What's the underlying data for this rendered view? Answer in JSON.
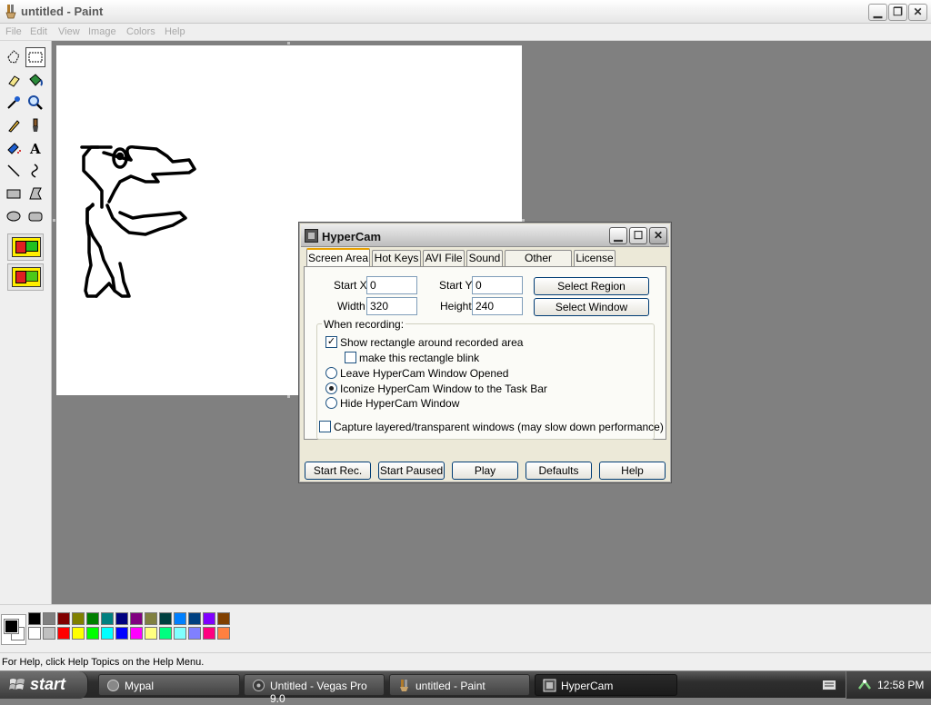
{
  "paint": {
    "title": "untitled - Paint",
    "menu": [
      "File",
      "Edit",
      "View",
      "Image",
      "Colors",
      "Help"
    ],
    "status": "For Help, click Help Topics on the Help Menu.",
    "palette_top": [
      "#000000",
      "#808080",
      "#800000",
      "#808000",
      "#008000",
      "#008080",
      "#000080",
      "#800080",
      "#808040",
      "#004040",
      "#0080ff",
      "#004080",
      "#8000ff",
      "#804000"
    ],
    "palette_bottom": [
      "#ffffff",
      "#c0c0c0",
      "#ff0000",
      "#ffff00",
      "#00ff00",
      "#00ffff",
      "#0000ff",
      "#ff00ff",
      "#ffff80",
      "#00ff80",
      "#80ffff",
      "#8080ff",
      "#ff0080",
      "#ff8040"
    ],
    "tools": [
      "free-select",
      "rect-select",
      "eraser",
      "fill",
      "color-picker",
      "magnifier",
      "pencil",
      "brush",
      "airbrush",
      "text",
      "line",
      "curve",
      "rectangle",
      "polygon",
      "ellipse",
      "rounded-rect"
    ]
  },
  "hypercam": {
    "title": "HyperCam",
    "tabs": [
      "Screen Area",
      "Hot Keys",
      "AVI File",
      "Sound",
      "Other Options",
      "License"
    ],
    "active_tab": "Screen Area",
    "start_x_label": "Start X",
    "start_x": "0",
    "start_y_label": "Start Y",
    "start_y": "0",
    "width_label": "Width",
    "width": "320",
    "height_label": "Height",
    "height": "240",
    "select_region": "Select Region",
    "select_window": "Select Window",
    "group_title": "When recording:",
    "show_rect": "Show rectangle around recorded area",
    "blink": "make this rectangle blink",
    "leave_opened": "Leave HyperCam Window Opened",
    "iconize": "Iconize HyperCam Window to the Task Bar",
    "hide": "Hide HyperCam Window",
    "capture_layered": "Capture layered/transparent windows (may slow down performance)",
    "buttons": [
      "Start Rec.",
      "Start Paused",
      "Play",
      "Defaults",
      "Help"
    ]
  },
  "taskbar": {
    "start": "start",
    "tasks": [
      "Mypal",
      "Untitled - Vegas Pro 9.0",
      "untitled - Paint",
      "HyperCam"
    ],
    "active_task": "HyperCam",
    "clock": "12:58 PM"
  }
}
